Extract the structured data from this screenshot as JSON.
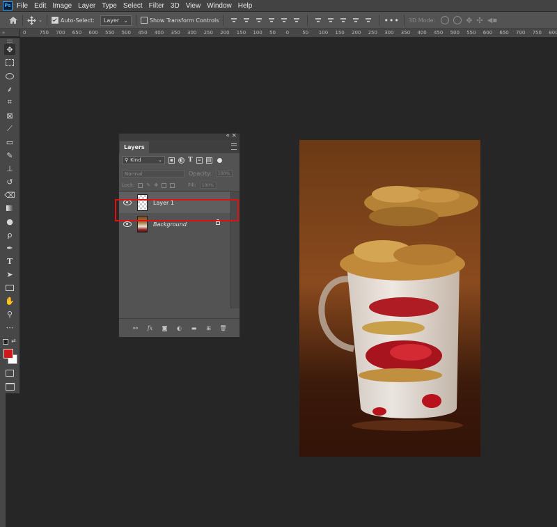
{
  "menubar": {
    "logo": "Ps",
    "items": [
      "File",
      "Edit",
      "Image",
      "Layer",
      "Type",
      "Select",
      "Filter",
      "3D",
      "View",
      "Window",
      "Help"
    ]
  },
  "options": {
    "auto_select_label": "Auto-Select:",
    "auto_select_target": "Layer",
    "show_transform_label": "Show Transform Controls",
    "mode_3d_label": "3D Mode:"
  },
  "ruler": {
    "corner": "»",
    "ticks": [
      "0",
      "750",
      "700",
      "650",
      "600",
      "550",
      "500",
      "450",
      "400",
      "350",
      "300",
      "250",
      "200",
      "150",
      "100",
      "50",
      "0",
      "50",
      "100",
      "150",
      "200",
      "250",
      "300",
      "350",
      "400",
      "450",
      "500",
      "550",
      "600",
      "650",
      "700",
      "750",
      "800"
    ]
  },
  "tools": [
    "move-tool",
    "marquee-tool",
    "lasso-tool",
    "quick-select-tool",
    "crop-tool",
    "frame-tool",
    "eyedropper-tool",
    "healing-brush-tool",
    "brush-tool",
    "clone-stamp-tool",
    "history-brush-tool",
    "eraser-tool",
    "gradient-tool",
    "blur-tool",
    "dodge-tool",
    "pen-tool",
    "type-tool",
    "path-select-tool",
    "rectangle-tool",
    "hand-tool",
    "zoom-tool",
    "more-tools"
  ],
  "colors": {
    "foreground": "#cc1a1a",
    "background": "#ffffff",
    "selection_highlight": "#e01010"
  },
  "layers_panel": {
    "tab_label": "Layers",
    "filter_kind": "Kind",
    "blend_mode": "Normal",
    "opacity_label": "Opacity:",
    "opacity_value": "100%",
    "lock_label": "Lock:",
    "fill_label": "Fill:",
    "fill_value": "100%",
    "layers": [
      {
        "name": "Layer 1",
        "selected": true,
        "locked": false
      },
      {
        "name": "Background",
        "selected": false,
        "locked": true
      }
    ],
    "footer_icons": [
      "link-icon",
      "fx-icon",
      "mask-icon",
      "adjustment-icon",
      "group-folder-icon",
      "new-layer-icon",
      "trash-icon"
    ]
  }
}
